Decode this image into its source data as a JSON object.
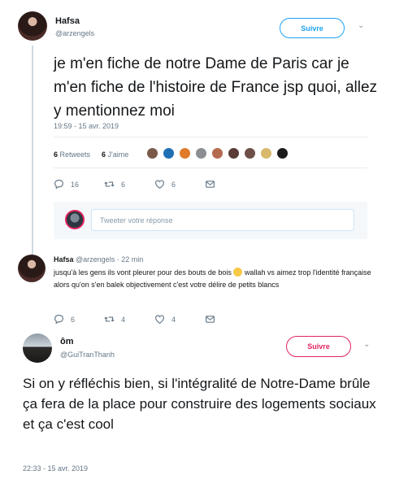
{
  "tweet1": {
    "author_name": "Hafsa",
    "author_handle": "@arzengels",
    "follow_label": "Suivre",
    "text": "je m'en fiche de notre Dame de Paris car je m'en fiche de l'histoire de France jsp quoi, allez y mentionnez moi",
    "timestamp": "19:59 - 15 avr. 2019",
    "retweets_count": "6",
    "retweets_label": "Retweets",
    "likes_count": "6",
    "likes_label": "J'aime",
    "actions": {
      "replies": "16",
      "retweets": "6",
      "likes": "6"
    },
    "reply_placeholder": "Tweeter votre réponse"
  },
  "reply": {
    "author_name": "Hafsa",
    "author_handle": "@arzengels",
    "time_ago": "· 22 min",
    "text_before_emoji": "jusqu'à les gens ils vont pleurer pour des bouts de bois",
    "text_after_emoji": "wallah vs aimez trop l'identité française alors qu'on s'en balek objectivement c'est votre délire de petits blancs",
    "actions": {
      "replies": "6",
      "retweets": "4",
      "likes": "4"
    }
  },
  "tweet2": {
    "author_name": "ôm",
    "author_handle": "@GuiTranThanh",
    "follow_label": "Suivre",
    "text": "Si on y réfléchis bien, si l'intégralité de Notre-Dame brûle ça fera de la place pour construire des logements sociaux et ça c'est cool",
    "timestamp": "22:33 - 15 avr. 2019"
  },
  "colors": {
    "twitter_blue": "#1da1f2",
    "red_accent": "#e0245e",
    "muted": "#657786"
  },
  "icons": [
    "reply-icon",
    "retweet-icon",
    "heart-icon",
    "mail-icon",
    "chevron-down-icon"
  ]
}
